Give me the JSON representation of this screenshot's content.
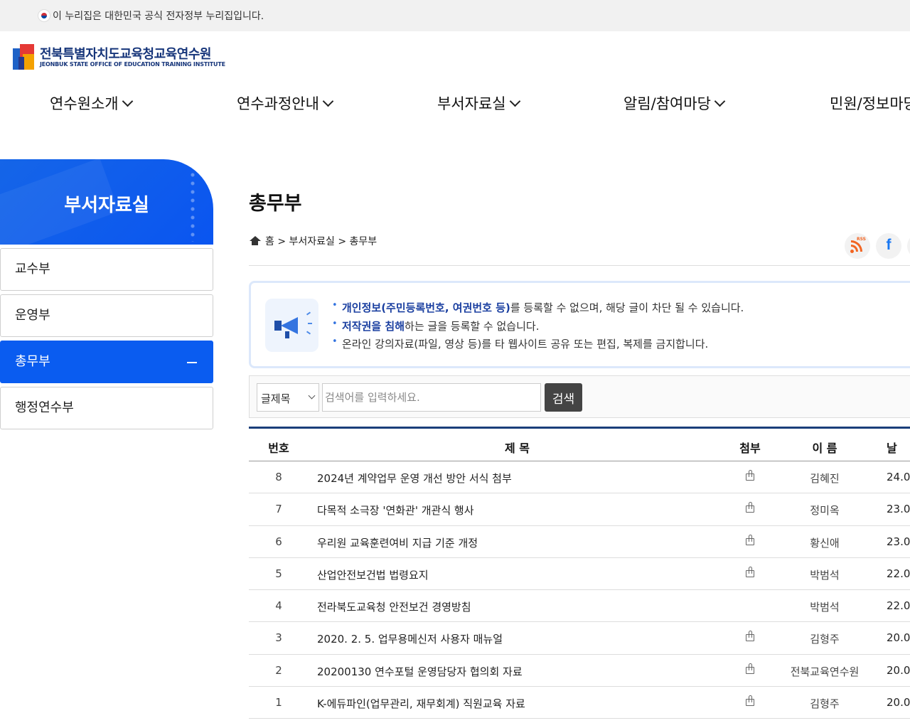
{
  "gov_banner": {
    "text": "이 누리집은 대한민국 공식 전자정부 누리집입니다."
  },
  "logo": {
    "name_ko": "전북특별자치도교육청교육연수원",
    "name_en": "JEONBUK STATE OFFICE OF EDUCATION TRAINING INSTITUTE"
  },
  "gnb": [
    {
      "label": "연수원소개"
    },
    {
      "label": "연수과정안내"
    },
    {
      "label": "부서자료실"
    },
    {
      "label": "알림/참여마당"
    },
    {
      "label": "민원/정보마당"
    }
  ],
  "lnb": {
    "title": "부서자료실",
    "items": [
      {
        "label": "교수부",
        "active": false
      },
      {
        "label": "운영부",
        "active": false
      },
      {
        "label": "총무부",
        "active": true
      },
      {
        "label": "행정연수부",
        "active": false
      }
    ]
  },
  "page": {
    "title": "총무부",
    "breadcrumb": "홈 > 부서자료실 > 총무부"
  },
  "sns": {
    "rss_label": "RSS",
    "facebook_label": "f"
  },
  "notice": {
    "line1_hl": "개인정보(주민등록번호, 여권번호 등)",
    "line1_rest": "를 등록할 수 없으며, 해당 글이 차단 될 수 있습니다.",
    "line2_hl": "저작권을 침해",
    "line2_rest": "하는 글을 등록할 수 없습니다.",
    "line3": "온라인 강의자료(파일, 영상 등)를 타 웹사이트 공유 또는 편집, 복제를 금지합니다."
  },
  "search": {
    "select_value": "글제목",
    "placeholder": "검색어를 입력하세요.",
    "button_label": "검색"
  },
  "board": {
    "headers": {
      "num": "번호",
      "title": "제 목",
      "attach": "첨부",
      "name": "이 름",
      "date": "날"
    },
    "rows": [
      {
        "num": "8",
        "title": "2024년 계약업무 운영 개선 방안 서식 첨부",
        "attach": true,
        "name": "김혜진",
        "date": "24.0"
      },
      {
        "num": "7",
        "title": "다목적 소극장 '연화관' 개관식 행사",
        "attach": true,
        "name": "정미옥",
        "date": "23.0"
      },
      {
        "num": "6",
        "title": "우리원 교육훈련여비 지급 기준 개정",
        "attach": true,
        "name": "황신애",
        "date": "23.0"
      },
      {
        "num": "5",
        "title": "산업안전보건법 법령요지",
        "attach": true,
        "name": "박범석",
        "date": "22.0"
      },
      {
        "num": "4",
        "title": "전라북도교육청 안전보건 경영방침",
        "attach": false,
        "name": "박범석",
        "date": "22.0"
      },
      {
        "num": "3",
        "title": "2020. 2. 5. 업무용메신저 사용자 매뉴얼",
        "attach": true,
        "name": "김형주",
        "date": "20.0"
      },
      {
        "num": "2",
        "title": "20200130 연수포털 운영담당자 협의회 자료",
        "attach": true,
        "name": "전북교육연수원",
        "date": "20.0"
      },
      {
        "num": "1",
        "title": "K-에듀파인(업무관리, 재무회계) 직원교육 자료",
        "attach": true,
        "name": "김형주",
        "date": "20.0"
      }
    ]
  }
}
